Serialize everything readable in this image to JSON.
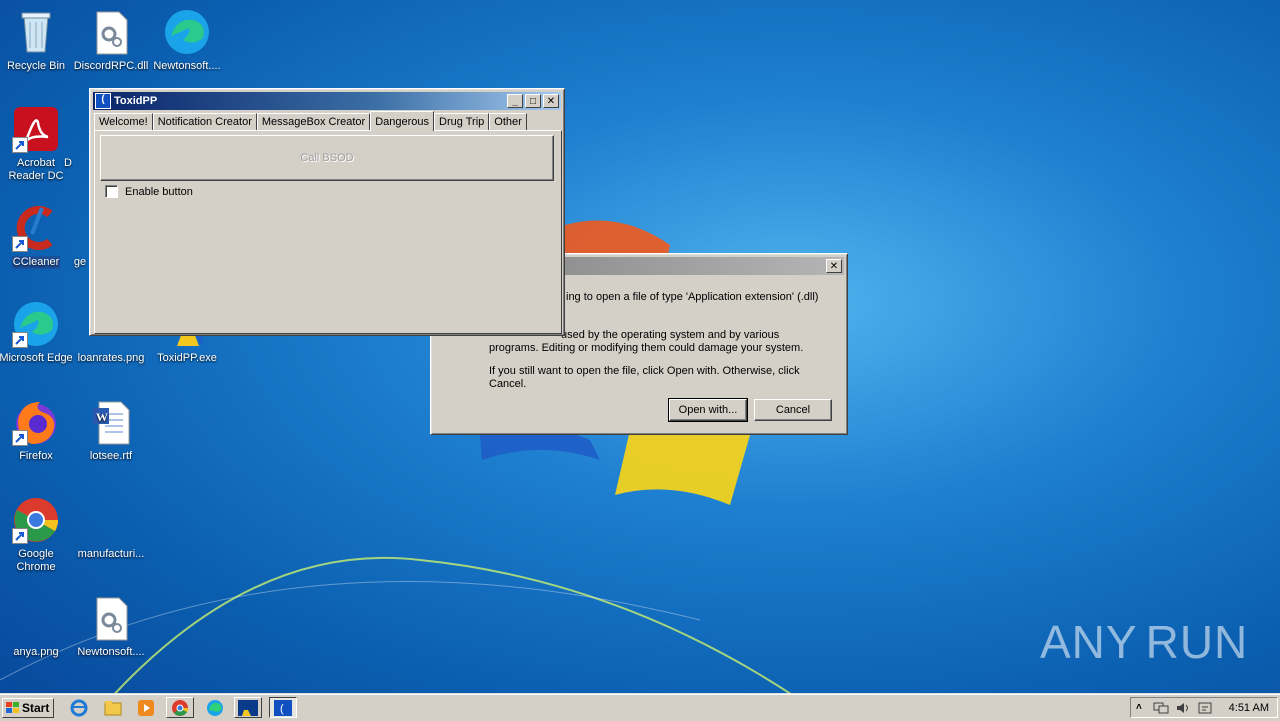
{
  "desktop": {
    "icons": [
      {
        "label": "Recycle Bin"
      },
      {
        "label": "DiscordRPC.dll"
      },
      {
        "label": "Newtonsoft...."
      },
      {
        "label": "Acrobat Reader DC"
      },
      {
        "label": "D"
      },
      {
        "label": "CCleaner"
      },
      {
        "label": "ge"
      },
      {
        "label": "Microsoft Edge"
      },
      {
        "label": "loanrates.png"
      },
      {
        "label": "ToxidPP.exe"
      },
      {
        "label": "Firefox"
      },
      {
        "label": "lotsee.rtf"
      },
      {
        "label": "Google Chrome"
      },
      {
        "label": "manufacturi..."
      },
      {
        "label": "anya.png"
      },
      {
        "label": "Newtonsoft...."
      }
    ]
  },
  "app_window": {
    "title": "ToxidPP",
    "tabs": [
      {
        "label": "Welcome!"
      },
      {
        "label": "Notification Creator"
      },
      {
        "label": "MessageBox Creator"
      },
      {
        "label": "Dangerous"
      },
      {
        "label": "Drug Trip"
      },
      {
        "label": "Other"
      }
    ],
    "active_tab": "Dangerous",
    "bsod_button": "Call BSOD",
    "enable_checkbox": "Enable button"
  },
  "dialog": {
    "line1": "ing to open a file of type 'Application extension' (.dll)",
    "line2a": "used by the operating system and by various",
    "line2b": "programs. Editing or modifying them could damage your system.",
    "line3a": "If you still want to open the file, click Open with. Otherwise, click",
    "line3b": "Cancel.",
    "open_with_button": "Open with...",
    "cancel_button": "Cancel"
  },
  "taskbar": {
    "start_label": "Start",
    "clock": "4:51 AM"
  },
  "watermark": {
    "left": "ANY",
    "right": "RUN"
  },
  "colors": {
    "titlebar_active": "#0a246a",
    "window_face": "#d4d0c8",
    "desktop": "#1e7fd0"
  }
}
